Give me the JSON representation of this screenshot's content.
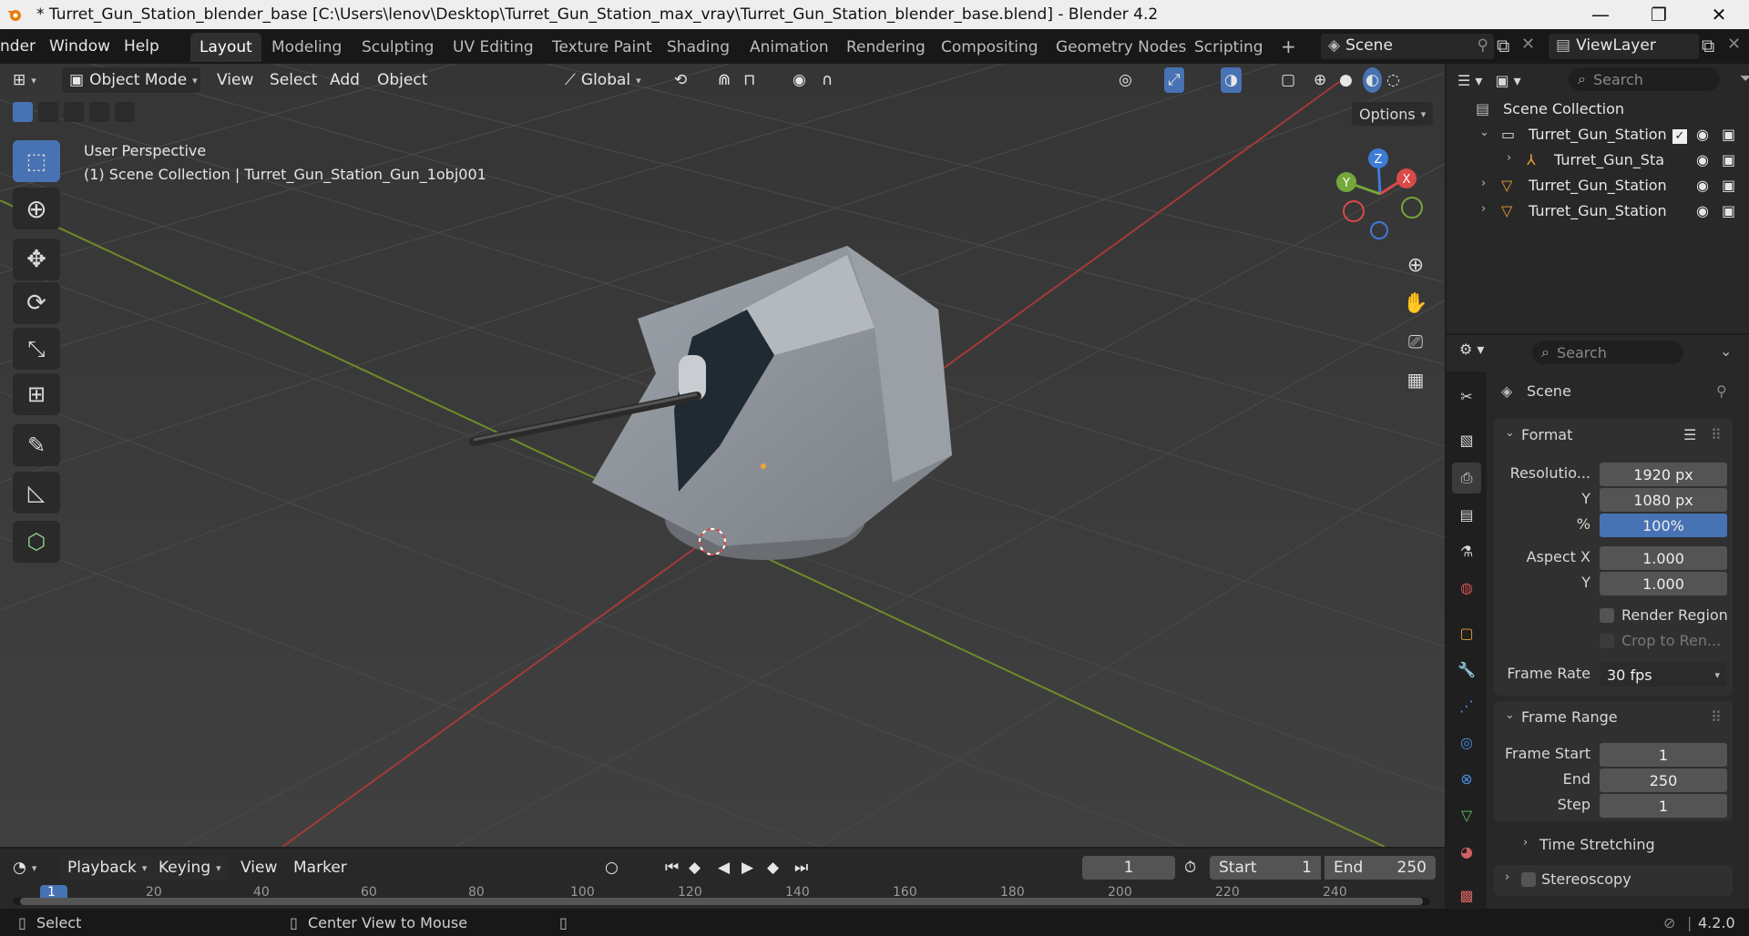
{
  "window": {
    "title": "* Turret_Gun_Station_blender_base [C:\\Users\\lenov\\Desktop\\Turret_Gun_Station_max_vray\\Turret_Gun_Station_blender_base.blend] - Blender 4.2",
    "minimize": "—",
    "restore": "❐",
    "close": "✕"
  },
  "menu": [
    "nder",
    "Window",
    "Help"
  ],
  "workspaces": [
    "Layout",
    "Modeling",
    "Sculpting",
    "UV Editing",
    "Texture Paint",
    "Shading",
    "Animation",
    "Rendering",
    "Compositing",
    "Geometry Nodes",
    "Scripting"
  ],
  "workspace_add": "+",
  "scene_name": "Scene",
  "view_layer": "ViewLayer",
  "viewport": {
    "mode": "Object Mode",
    "menus": [
      "View",
      "Select",
      "Add",
      "Object"
    ],
    "transform_orientation": "Global",
    "options_label": "Options",
    "perspective_label": "User Perspective",
    "collection_label": "(1) Scene Collection | Turret_Gun_Station_Gun_1obj001",
    "gizmo": {
      "x": "X",
      "y": "Y",
      "z": "Z"
    }
  },
  "outliner": {
    "search_placeholder": "Search",
    "root": "Scene Collection",
    "items": [
      {
        "label": "Turret_Gun_Station",
        "icon": "collection-icon"
      },
      {
        "label": "Turret_Gun_Sta",
        "icon": "armature-icon"
      },
      {
        "label": "Turret_Gun_Station",
        "icon": "mesh-icon"
      },
      {
        "label": "Turret_Gun_Station",
        "icon": "mesh-icon"
      }
    ]
  },
  "properties": {
    "search_placeholder": "Search",
    "scene_label": "Scene",
    "format": {
      "header": "Format",
      "resolution_label": "Resolutio...",
      "res_x": "1920 px",
      "y_label": "Y",
      "res_y": "1080 px",
      "pct_label": "%",
      "pct": "100%",
      "aspect_x_label": "Aspect X",
      "aspect_x": "1.000",
      "aspect_y_label": "Y",
      "aspect_y": "1.000",
      "render_region": "Render Region",
      "crop": "Crop to Ren...",
      "frame_rate_label": "Frame Rate",
      "frame_rate": "30 fps"
    },
    "frame_range": {
      "header": "Frame Range",
      "start_label": "Frame Start",
      "start": "1",
      "end_label": "End",
      "end": "250",
      "step_label": "Step",
      "step": "1"
    },
    "time_stretching": "Time Stretching",
    "stereoscopy": "Stereoscopy"
  },
  "timeline": {
    "menus": [
      "Playback",
      "Keying",
      "View",
      "Marker"
    ],
    "current_frame": "1",
    "start_label": "Start",
    "start": "1",
    "end_label": "End",
    "end": "250",
    "ticks": [
      "1",
      "20",
      "40",
      "60",
      "80",
      "100",
      "120",
      "140",
      "160",
      "180",
      "200",
      "220",
      "240"
    ]
  },
  "status": {
    "select": "Select",
    "center": "Center View to Mouse",
    "version": "4.2.0"
  }
}
